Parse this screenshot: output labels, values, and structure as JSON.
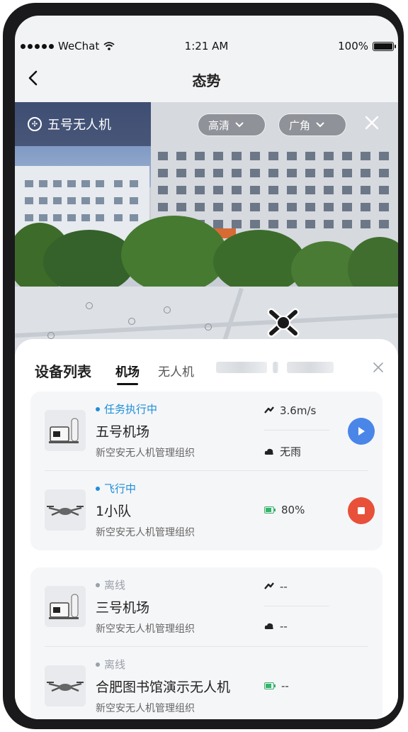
{
  "statusbar": {
    "carrier": "WeChat",
    "time": "1:21 AM",
    "battery": "100%"
  },
  "navbar": {
    "title": "态势"
  },
  "video": {
    "drone_label": "五号无人机",
    "quality_label": "高清",
    "view_label": "广角"
  },
  "map_labels": [
    "",
    "",
    "",
    "",
    ""
  ],
  "sheet": {
    "title": "设备列表",
    "tabs": [
      {
        "label": "机场",
        "active": true
      },
      {
        "label": "无人机",
        "active": false
      }
    ]
  },
  "groups": [
    {
      "items": [
        {
          "kind": "dock",
          "status": "任务执行中",
          "status_color": "#1c8fd8",
          "name": "五号机场",
          "org": "新空安无人机管理组织",
          "metrics": [
            {
              "icon": "wind-icon",
              "value": "3.6m/s"
            },
            {
              "icon": "weather-icon",
              "value": "无雨"
            }
          ],
          "action": "play",
          "action_color": "#4a86e8"
        },
        {
          "kind": "drone",
          "status": "飞行中",
          "status_color": "#1c8fd8",
          "name": "1小队",
          "org": "新空安无人机管理组织",
          "metrics": [
            {
              "icon": "battery-icon",
              "value": "80%"
            }
          ],
          "action": "stop",
          "action_color": "#e8503a"
        }
      ]
    },
    {
      "items": [
        {
          "kind": "dock",
          "status": "离线",
          "status_color": "#9aa0a8",
          "name": "三号机场",
          "org": "新空安无人机管理组织",
          "metrics": [
            {
              "icon": "wind-icon",
              "value": "--"
            },
            {
              "icon": "weather-icon",
              "value": "--"
            }
          ],
          "action": null
        },
        {
          "kind": "drone",
          "status": "离线",
          "status_color": "#9aa0a8",
          "name": "合肥图书馆演示无人机",
          "org": "新空安无人机管理组织",
          "metrics": [
            {
              "icon": "battery-icon",
              "value": "--"
            }
          ],
          "action": null
        }
      ]
    }
  ]
}
